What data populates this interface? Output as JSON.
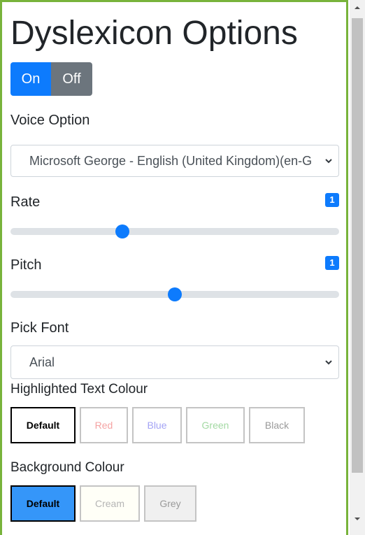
{
  "title": "Dyslexicon Options",
  "toggle": {
    "on_label": "On",
    "off_label": "Off"
  },
  "voice": {
    "label": "Voice Option",
    "selected": "Microsoft George - English (United Kingdom)(en-GB)"
  },
  "rate": {
    "label": "Rate",
    "value": "1",
    "slider_fraction": 0.34
  },
  "pitch": {
    "label": "Pitch",
    "value": "1",
    "slider_fraction": 0.5
  },
  "font": {
    "label": "Pick Font",
    "selected": "Arial"
  },
  "highlight": {
    "label": "Highlighted Text Colour",
    "options": [
      {
        "label": "Default",
        "text_color": "#000000",
        "bg": "#ffffff",
        "selected": true
      },
      {
        "label": "Red",
        "text_color": "#f5a3a3",
        "bg": "#ffffff"
      },
      {
        "label": "Blue",
        "text_color": "#a3a3f5",
        "bg": "#ffffff"
      },
      {
        "label": "Green",
        "text_color": "#a3d9a3",
        "bg": "#ffffff"
      },
      {
        "label": "Black",
        "text_color": "#9a9a9a",
        "bg": "#ffffff"
      }
    ]
  },
  "background": {
    "label": "Background Colour",
    "options": [
      {
        "label": "Default",
        "text_color": "#000000",
        "bg": "#3596f9",
        "selected": true
      },
      {
        "label": "Cream",
        "text_color": "#b5b5b5",
        "bg": "#fffff7"
      },
      {
        "label": "Grey",
        "text_color": "#9a9a9a",
        "bg": "#f0f0f0"
      }
    ]
  },
  "colors": {
    "primary": "#0d7bfd",
    "secondary": "#6c757d",
    "frame": "#78b33b"
  }
}
